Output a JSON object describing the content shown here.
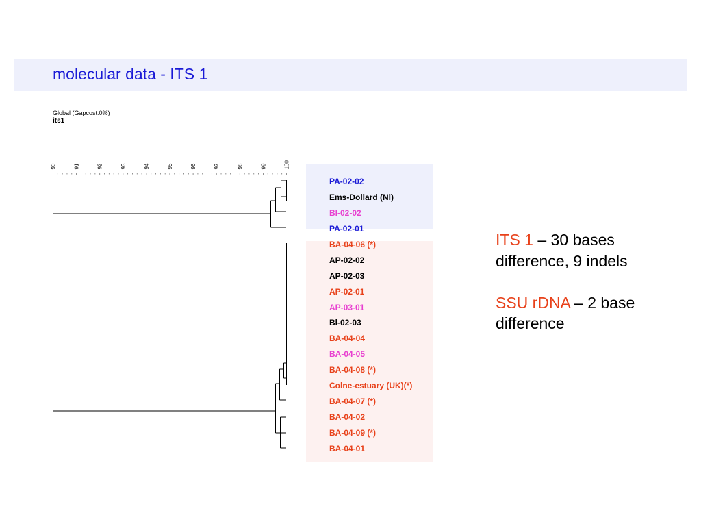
{
  "slide": {
    "title": "molecular data - ITS 1",
    "method": "Global (Gapcost:0%)",
    "dataset": "its1"
  },
  "scale": {
    "ticks": [
      "90",
      "91",
      "92",
      "93",
      "94",
      "95",
      "96",
      "97",
      "98",
      "99",
      "100"
    ]
  },
  "leaves": [
    {
      "label": "PA-02-02",
      "color": "#1a1ad6"
    },
    {
      "label": "Ems-Dollard (Nl)",
      "color": "#000000"
    },
    {
      "label": "Bl-02-02",
      "color": "#e83fd0"
    },
    {
      "label": "PA-02-01",
      "color": "#1a1ad6"
    },
    {
      "label": "BA-04-06 (*)",
      "color": "#e8411a"
    },
    {
      "label": "AP-02-02",
      "color": "#000000"
    },
    {
      "label": "AP-02-03",
      "color": "#000000"
    },
    {
      "label": "AP-02-01",
      "color": "#e8411a"
    },
    {
      "label": "AP-03-01",
      "color": "#e83fd0"
    },
    {
      "label": "Bl-02-03",
      "color": "#000000"
    },
    {
      "label": "BA-04-04",
      "color": "#e8411a"
    },
    {
      "label": "BA-04-05",
      "color": "#e83fd0"
    },
    {
      "label": "BA-04-08 (*)",
      "color": "#e8411a"
    },
    {
      "label": "Colne-estuary (UK)(*)",
      "color": "#e8411a"
    },
    {
      "label": "BA-04-07 (*)",
      "color": "#e8411a"
    },
    {
      "label": "BA-04-02",
      "color": "#e8411a"
    },
    {
      "label": "BA-04-09 (*)",
      "color": "#e8411a"
    },
    {
      "label": "BA-04-01",
      "color": "#e8411a"
    }
  ],
  "notes": {
    "its_label": "ITS 1",
    "its_rest": " – 30 bases",
    "its_line2": "difference, 9 indels",
    "ssu_label": "SSU rDNA",
    "ssu_rest": " – 2 base",
    "ssu_line2": "difference"
  },
  "colors": {
    "title": "#1a1ad6",
    "highlight": "#e8411a",
    "blue_group_bg": "#eef0fc",
    "pink_group_bg": "#fdf1f0"
  }
}
